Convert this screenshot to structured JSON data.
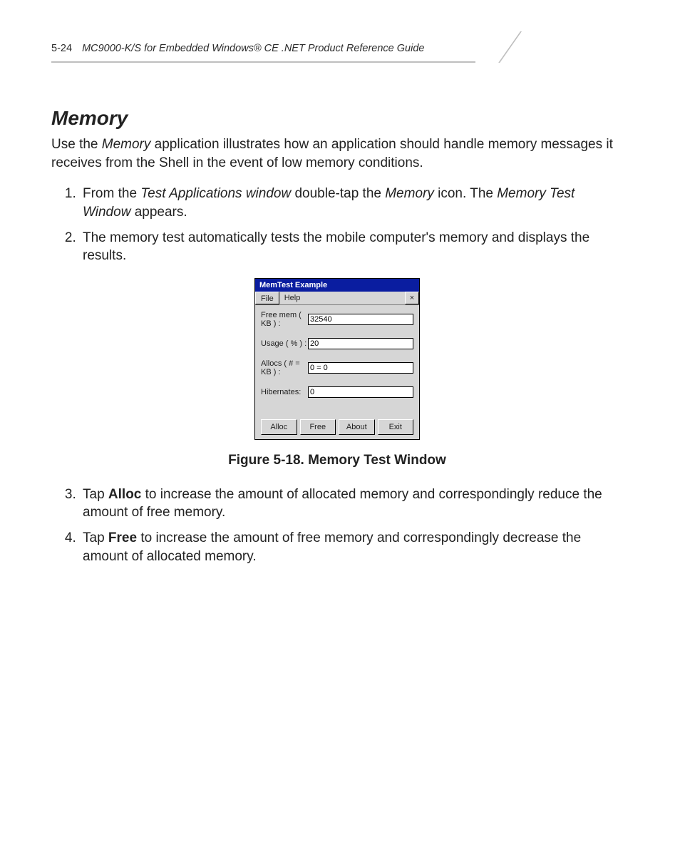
{
  "header": {
    "page_number": "5-24",
    "title": "MC9000-K/S for Embedded Windows® CE .NET Product Reference Guide"
  },
  "section": {
    "title": "Memory",
    "intro_parts": [
      "Use the ",
      "Memory",
      " application illustrates how an application should handle memory messages it receives from the Shell in the event of low memory conditions."
    ]
  },
  "steps": [
    {
      "frags": [
        {
          "t": "From the "
        },
        {
          "t": "Test Applications window",
          "i": true
        },
        {
          "t": " double-tap the "
        },
        {
          "t": "Memory",
          "i": true
        },
        {
          "t": " icon. The "
        },
        {
          "t": "Memory Test Window",
          "i": true
        },
        {
          "t": " appears."
        }
      ]
    },
    {
      "frags": [
        {
          "t": "The memory test automatically tests the mobile computer's memory and displays the results."
        }
      ]
    },
    {
      "frags": [
        {
          "t": "Tap "
        },
        {
          "t": "Alloc",
          "b": true
        },
        {
          "t": " to increase the amount of allocated memory and correspondingly reduce the amount of free memory."
        }
      ]
    },
    {
      "frags": [
        {
          "t": "Tap "
        },
        {
          "t": "Free",
          "b": true
        },
        {
          "t": " to increase the amount of free memory and correspondingly decrease the amount of allocated memory."
        }
      ]
    }
  ],
  "memtest": {
    "title": "MemTest Example",
    "menu_file": "File",
    "menu_help": "Help",
    "close": "×",
    "fields": {
      "free_mem": {
        "label": "Free mem ( KB ) :",
        "value": "32540"
      },
      "usage": {
        "label": "Usage ( % ) :",
        "value": "20"
      },
      "allocs": {
        "label": "Allocs ( # = KB ) :",
        "value": "0 = 0"
      },
      "hibernates": {
        "label": "Hibernates:",
        "value": "0"
      }
    },
    "buttons": {
      "alloc": "Alloc",
      "free": "Free",
      "about": "About",
      "exit": "Exit"
    }
  },
  "figure_caption": "Figure 5-18.  Memory Test Window"
}
